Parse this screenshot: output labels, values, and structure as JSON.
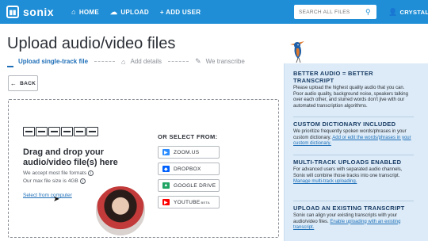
{
  "brand": {
    "name": "sonix"
  },
  "nav": {
    "home": "HOME",
    "upload": "UPLOAD",
    "add_user": "+ ADD USER"
  },
  "search": {
    "placeholder": "SEARCH ALL FILES"
  },
  "user": {
    "name": "CRYSTAL"
  },
  "page": {
    "title": "Upload audio/video files"
  },
  "steps": [
    {
      "label": "Upload single-track file",
      "state": "active"
    },
    {
      "label": "Add details",
      "state": "inactive"
    },
    {
      "label": "We transcribe",
      "state": "inactive"
    }
  ],
  "back": {
    "label": "BACK"
  },
  "dropzone": {
    "title": "Drag and drop your audio/video file(s) here",
    "accept_text": "We accept most file formats",
    "max_size_text": "Our max file size is 4GB",
    "select_link": "Select from computer"
  },
  "sources": {
    "title": "OR SELECT FROM:",
    "items": [
      {
        "label": "ZOOM.US",
        "icon": "zoom-icon",
        "color": "#2d8cff"
      },
      {
        "label": "DROPBOX",
        "icon": "dropbox-icon",
        "color": "#0061fe"
      },
      {
        "label": "GOOGLE DRIVE",
        "icon": "google-drive-icon",
        "color": "#1fa463"
      },
      {
        "label": "YOUTUBE",
        "badge": "BETA",
        "icon": "youtube-icon",
        "color": "#ff0000"
      }
    ]
  },
  "sidebar": {
    "sections": [
      {
        "title": "BETTER AUDIO = BETTER TRANSCRIPT",
        "body": "Please upload the highest quality audio that you can. Poor audio quality, background noise, speakers talking over each other, and slurred words don't jive with our automated transcription algorithms."
      },
      {
        "title": "CUSTOM DICTIONARY INCLUDED",
        "body": "We prioritize frequently spoken words/phrases in your custom dictionary.",
        "link": "Add or edit the words/phrases in your custom dictionary."
      },
      {
        "title": "MULTI-TRACK UPLOADS ENABLED",
        "body": "For advanced users with separated audio channels, Sonix will combine those tracks into one transcript.",
        "link": "Manage multi-track uploading."
      },
      {
        "title": "UPLOAD AN EXISTING TRANSCRIPT",
        "body": "Sonix can align your existing transcripts with your audio/video files.",
        "link": "Enable uploading with an existing transcript."
      }
    ]
  },
  "colors": {
    "topbar": "#1f8ed6",
    "link": "#1f6fb8",
    "sidebar_bg": "#dcebf7",
    "sidebar_title": "#1a3d66"
  }
}
